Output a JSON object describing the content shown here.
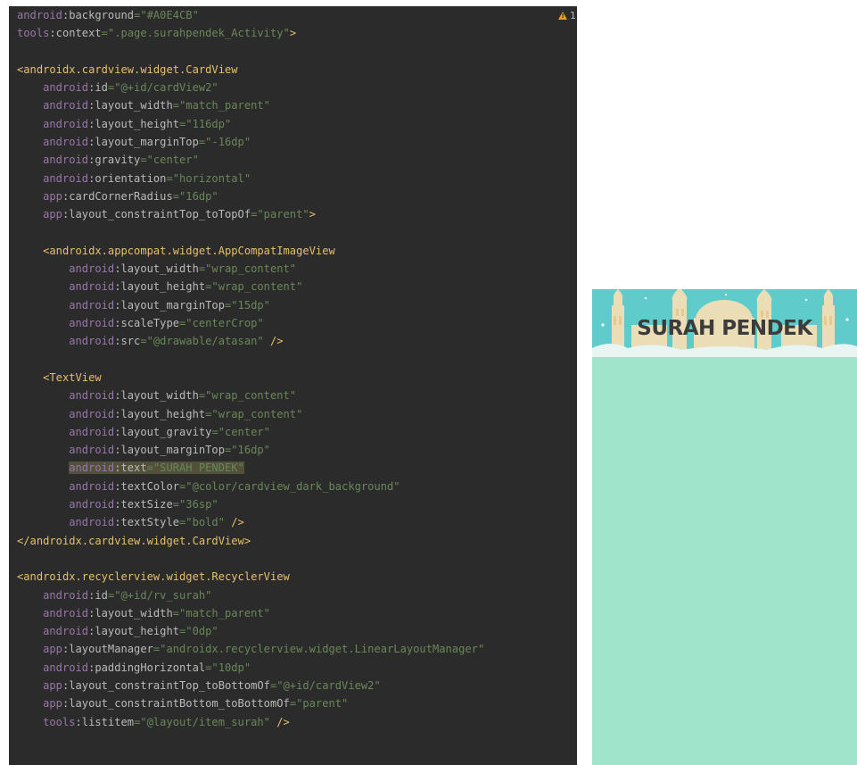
{
  "editor": {
    "warning_count": "1",
    "lines": [
      [
        {
          "c": "ns",
          "t": "android"
        },
        {
          "c": "attr",
          "t": ":background"
        },
        {
          "c": "val",
          "t": "=\"#A0E4CB\""
        }
      ],
      [
        {
          "c": "ns",
          "t": "tools"
        },
        {
          "c": "attr",
          "t": ":context"
        },
        {
          "c": "val",
          "t": "=\".page.surahpendek_Activity\""
        },
        {
          "c": "tag",
          "t": ">"
        }
      ],
      [],
      [
        {
          "c": "tag",
          "t": "<androidx.cardview.widget.CardView"
        }
      ],
      [
        {
          "c": "pad",
          "t": "    "
        },
        {
          "c": "ns",
          "t": "android"
        },
        {
          "c": "attr",
          "t": ":id"
        },
        {
          "c": "val",
          "t": "=\"@+id/cardView2\""
        }
      ],
      [
        {
          "c": "pad",
          "t": "    "
        },
        {
          "c": "ns",
          "t": "android"
        },
        {
          "c": "attr",
          "t": ":layout_width"
        },
        {
          "c": "val",
          "t": "=\"match_parent\""
        }
      ],
      [
        {
          "c": "pad",
          "t": "    "
        },
        {
          "c": "ns",
          "t": "android"
        },
        {
          "c": "attr",
          "t": ":layout_height"
        },
        {
          "c": "val",
          "t": "=\"116dp\""
        }
      ],
      [
        {
          "c": "pad",
          "t": "    "
        },
        {
          "c": "ns",
          "t": "android"
        },
        {
          "c": "attr",
          "t": ":layout_marginTop"
        },
        {
          "c": "val",
          "t": "=\"-16dp\""
        }
      ],
      [
        {
          "c": "pad",
          "t": "    "
        },
        {
          "c": "ns",
          "t": "android"
        },
        {
          "c": "attr",
          "t": ":gravity"
        },
        {
          "c": "val",
          "t": "=\"center\""
        }
      ],
      [
        {
          "c": "pad",
          "t": "    "
        },
        {
          "c": "ns",
          "t": "android"
        },
        {
          "c": "attr",
          "t": ":orientation"
        },
        {
          "c": "val",
          "t": "=\"horizontal\""
        }
      ],
      [
        {
          "c": "pad",
          "t": "    "
        },
        {
          "c": "ns",
          "t": "app"
        },
        {
          "c": "attr",
          "t": ":cardCornerRadius"
        },
        {
          "c": "val",
          "t": "=\"16dp\""
        }
      ],
      [
        {
          "c": "pad",
          "t": "    "
        },
        {
          "c": "ns",
          "t": "app"
        },
        {
          "c": "attr",
          "t": ":layout_constraintTop_toTopOf"
        },
        {
          "c": "val",
          "t": "=\"parent\""
        },
        {
          "c": "tag",
          "t": ">"
        }
      ],
      [],
      [
        {
          "c": "pad",
          "t": "    "
        },
        {
          "c": "tag",
          "t": "<androidx.appcompat.widget.AppCompatImageView"
        }
      ],
      [
        {
          "c": "pad",
          "t": "        "
        },
        {
          "c": "ns",
          "t": "android"
        },
        {
          "c": "attr",
          "t": ":layout_width"
        },
        {
          "c": "val",
          "t": "=\"wrap_content\""
        }
      ],
      [
        {
          "c": "pad",
          "t": "        "
        },
        {
          "c": "ns",
          "t": "android"
        },
        {
          "c": "attr",
          "t": ":layout_height"
        },
        {
          "c": "val",
          "t": "=\"wrap_content\""
        }
      ],
      [
        {
          "c": "pad",
          "t": "        "
        },
        {
          "c": "ns",
          "t": "android"
        },
        {
          "c": "attr",
          "t": ":layout_marginTop"
        },
        {
          "c": "val",
          "t": "=\"15dp\""
        }
      ],
      [
        {
          "c": "pad",
          "t": "        "
        },
        {
          "c": "ns",
          "t": "android"
        },
        {
          "c": "attr",
          "t": ":scaleType"
        },
        {
          "c": "val",
          "t": "=\"centerCrop\""
        }
      ],
      [
        {
          "c": "pad",
          "t": "        "
        },
        {
          "c": "ns",
          "t": "android"
        },
        {
          "c": "attr",
          "t": ":src"
        },
        {
          "c": "val",
          "t": "=\"@drawable/atasan\""
        },
        {
          "c": "tag",
          "t": " />"
        }
      ],
      [],
      [
        {
          "c": "pad",
          "t": "    "
        },
        {
          "c": "tag",
          "t": "<TextView"
        }
      ],
      [
        {
          "c": "pad",
          "t": "        "
        },
        {
          "c": "ns",
          "t": "android"
        },
        {
          "c": "attr",
          "t": ":layout_width"
        },
        {
          "c": "val",
          "t": "=\"wrap_content\""
        }
      ],
      [
        {
          "c": "pad",
          "t": "        "
        },
        {
          "c": "ns",
          "t": "android"
        },
        {
          "c": "attr",
          "t": ":layout_height"
        },
        {
          "c": "val",
          "t": "=\"wrap_content\""
        }
      ],
      [
        {
          "c": "pad",
          "t": "        "
        },
        {
          "c": "ns",
          "t": "android"
        },
        {
          "c": "attr",
          "t": ":layout_gravity"
        },
        {
          "c": "val",
          "t": "=\"center\""
        }
      ],
      [
        {
          "c": "pad",
          "t": "        "
        },
        {
          "c": "ns",
          "t": "android"
        },
        {
          "c": "attr",
          "t": ":layout_marginTop"
        },
        {
          "c": "val",
          "t": "=\"16dp\""
        }
      ],
      [
        {
          "c": "pad",
          "t": "        "
        },
        {
          "c": "ns hl",
          "t": "android"
        },
        {
          "c": "attr hl",
          "t": ":text"
        },
        {
          "c": "val hl",
          "t": "=\"SURAH PENDEK\""
        }
      ],
      [
        {
          "c": "pad",
          "t": "        "
        },
        {
          "c": "ns",
          "t": "android"
        },
        {
          "c": "attr",
          "t": ":textColor"
        },
        {
          "c": "val",
          "t": "=\"@color/cardview_dark_background\""
        }
      ],
      [
        {
          "c": "pad",
          "t": "        "
        },
        {
          "c": "ns",
          "t": "android"
        },
        {
          "c": "attr",
          "t": ":textSize"
        },
        {
          "c": "val",
          "t": "=\"36sp\""
        }
      ],
      [
        {
          "c": "pad",
          "t": "        "
        },
        {
          "c": "ns",
          "t": "android"
        },
        {
          "c": "attr",
          "t": ":textStyle"
        },
        {
          "c": "val",
          "t": "=\"bold\""
        },
        {
          "c": "tag",
          "t": " />"
        }
      ],
      [
        {
          "c": "tag",
          "t": "</androidx.cardview.widget.CardView>"
        }
      ],
      [],
      [
        {
          "c": "tag",
          "t": "<androidx.recyclerview.widget.RecyclerView"
        }
      ],
      [
        {
          "c": "pad",
          "t": "    "
        },
        {
          "c": "ns",
          "t": "android"
        },
        {
          "c": "attr",
          "t": ":id"
        },
        {
          "c": "val",
          "t": "=\"@+id/rv_surah\""
        }
      ],
      [
        {
          "c": "pad",
          "t": "    "
        },
        {
          "c": "ns",
          "t": "android"
        },
        {
          "c": "attr",
          "t": ":layout_width"
        },
        {
          "c": "val",
          "t": "=\"match_parent\""
        }
      ],
      [
        {
          "c": "pad",
          "t": "    "
        },
        {
          "c": "ns",
          "t": "android"
        },
        {
          "c": "attr",
          "t": ":layout_height"
        },
        {
          "c": "val",
          "t": "=\"0dp\""
        }
      ],
      [
        {
          "c": "pad",
          "t": "    "
        },
        {
          "c": "ns",
          "t": "app"
        },
        {
          "c": "attr",
          "t": ":layoutManager"
        },
        {
          "c": "val",
          "t": "=\"androidx.recyclerview.widget.LinearLayoutManager\""
        }
      ],
      [
        {
          "c": "pad",
          "t": "    "
        },
        {
          "c": "ns",
          "t": "android"
        },
        {
          "c": "attr",
          "t": ":paddingHorizontal"
        },
        {
          "c": "val",
          "t": "=\"10dp\""
        }
      ],
      [
        {
          "c": "pad",
          "t": "    "
        },
        {
          "c": "ns",
          "t": "app"
        },
        {
          "c": "attr",
          "t": ":layout_constraintTop_toBottomOf"
        },
        {
          "c": "val",
          "t": "=\"@+id/cardView2\""
        }
      ],
      [
        {
          "c": "pad",
          "t": "    "
        },
        {
          "c": "ns",
          "t": "app"
        },
        {
          "c": "attr",
          "t": ":layout_constraintBottom_toBottomOf"
        },
        {
          "c": "val",
          "t": "=\"parent\""
        }
      ],
      [
        {
          "c": "pad",
          "t": "    "
        },
        {
          "c": "ns",
          "t": "tools"
        },
        {
          "c": "attr",
          "t": ":listitem"
        },
        {
          "c": "val",
          "t": "=\"@layout/item_surah\""
        },
        {
          "c": "tag",
          "t": " />"
        }
      ]
    ]
  },
  "preview": {
    "background_color": "#A0E4CB",
    "card": {
      "title": "SURAH PENDEK",
      "title_color": "#3c3c3c"
    }
  }
}
